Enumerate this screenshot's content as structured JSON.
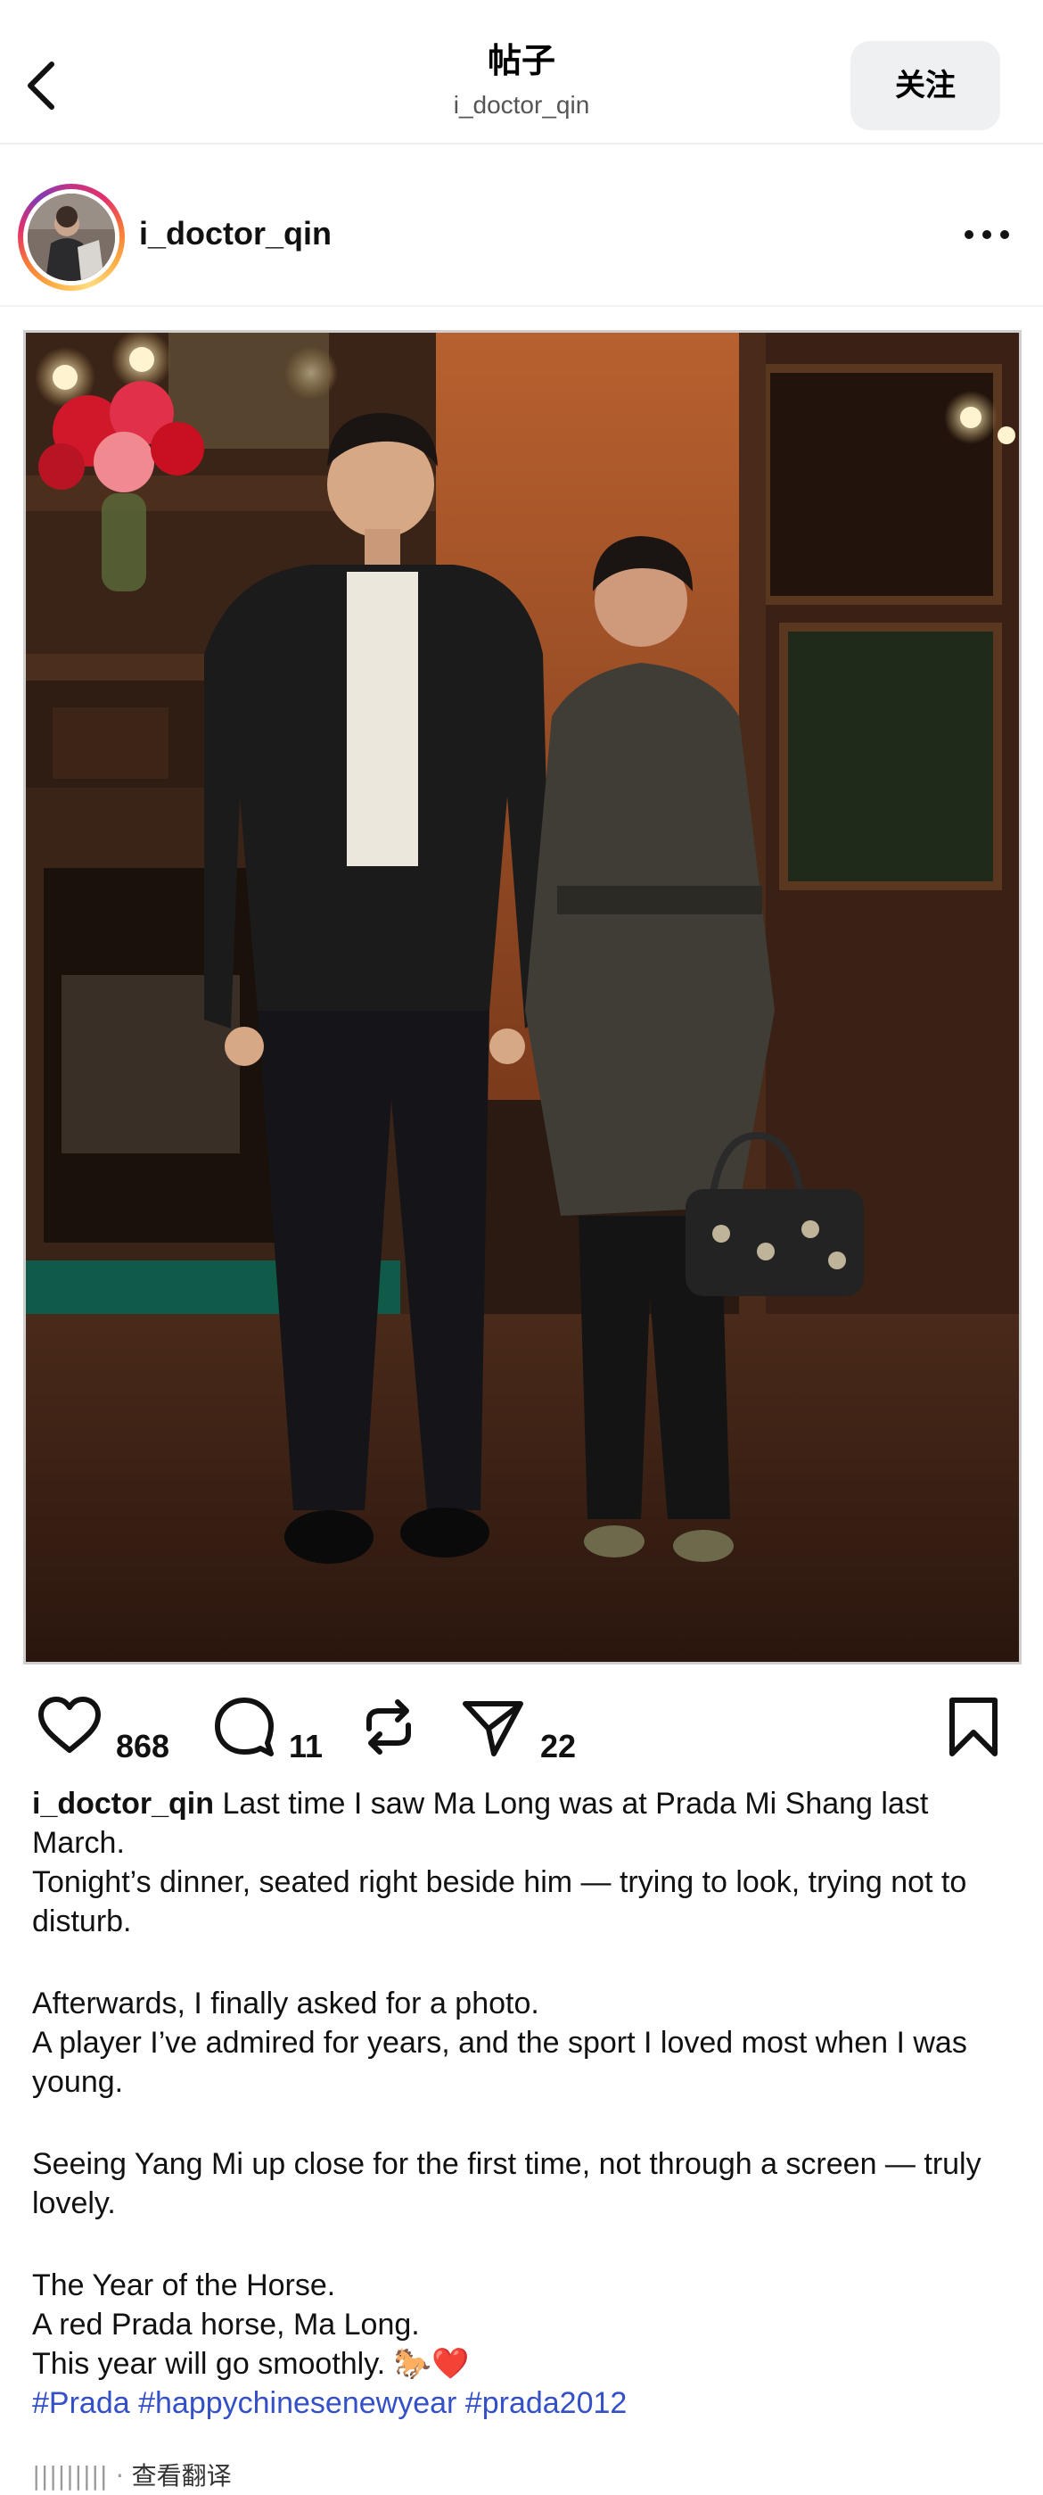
{
  "nav": {
    "title": "帖子",
    "subtitle": "i_doctor_qin",
    "follow_label": "关注"
  },
  "post": {
    "username": "i_doctor_qin",
    "photo_alt": "Two people posing in an ornate wood-paneled room"
  },
  "actions": {
    "likes": "868",
    "comments": "11",
    "shares": "22"
  },
  "caption": {
    "username": "i_doctor_qin",
    "line1": "Last time I saw Ma Long was at Prada Mi Shang last March.",
    "line2": "Tonight’s dinner, seated right beside him — trying to look, trying not to disturb.",
    "line3": "Afterwards, I finally asked for a photo.",
    "line4": "A player I’ve admired for years, and the sport I loved most when I was young.",
    "line5": "Seeing Yang Mi up close for the first time, not through a screen — truly lovely.",
    "line6": "The Year of the Horse.",
    "line7": "A red Prada horse, Ma Long.",
    "line8": "This year will go smoothly. 🐎❤️",
    "hashtags": [
      "#Prada",
      "#happychinesenewyear",
      "#prada2012"
    ]
  },
  "footer": {
    "dim_text": "|||||||||",
    "separator": "·",
    "translate_label": "查看翻译"
  },
  "colors": {
    "hashtag": "#3450c8",
    "follow_bg": "#eef0f2"
  }
}
